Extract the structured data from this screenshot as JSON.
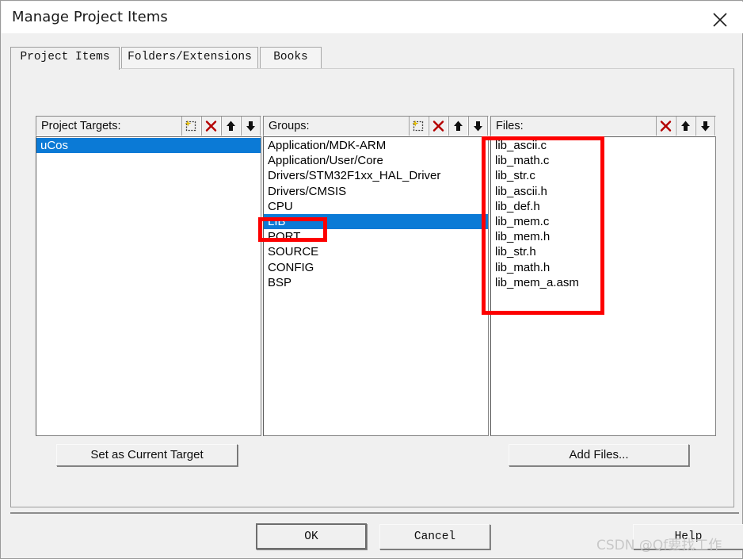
{
  "window": {
    "title": "Manage Project Items",
    "close_icon": "close-icon"
  },
  "tabs": [
    {
      "label": "Project Items",
      "active": true
    },
    {
      "label": "Folders/Extensions",
      "active": false
    },
    {
      "label": "Books",
      "active": false
    }
  ],
  "panels": {
    "targets": {
      "label": "Project Targets:",
      "tools": [
        "new-item-icon",
        "delete-icon",
        "move-up-icon",
        "move-down-icon"
      ],
      "items": [
        "uCos"
      ],
      "selected": "uCos",
      "button": "Set as Current Target"
    },
    "groups": {
      "label": "Groups:",
      "tools": [
        "new-item-icon",
        "delete-icon",
        "move-up-icon",
        "move-down-icon"
      ],
      "items": [
        "Application/MDK-ARM",
        "Application/User/Core",
        "Drivers/STM32F1xx_HAL_Driver",
        "Drivers/CMSIS",
        "CPU",
        "LIB",
        "PORT",
        "SOURCE",
        "CONFIG",
        "BSP"
      ],
      "selected": "LIB"
    },
    "files": {
      "label": "Files:",
      "tools": [
        "delete-icon",
        "move-up-icon",
        "move-down-icon"
      ],
      "items": [
        "lib_ascii.c",
        "lib_math.c",
        "lib_str.c",
        "lib_ascii.h",
        "lib_def.h",
        "lib_mem.c",
        "lib_mem.h",
        "lib_str.h",
        "lib_math.h",
        "lib_mem_a.asm"
      ],
      "button": "Add Files..."
    }
  },
  "dialog_buttons": {
    "ok": "OK",
    "cancel": "Cancel",
    "help": "Help"
  },
  "annotations": {
    "color": "#fd0000",
    "boxes": [
      "lib-group-highlight",
      "files-list-highlight"
    ]
  },
  "watermark": "CSDN @Qf要找工作"
}
